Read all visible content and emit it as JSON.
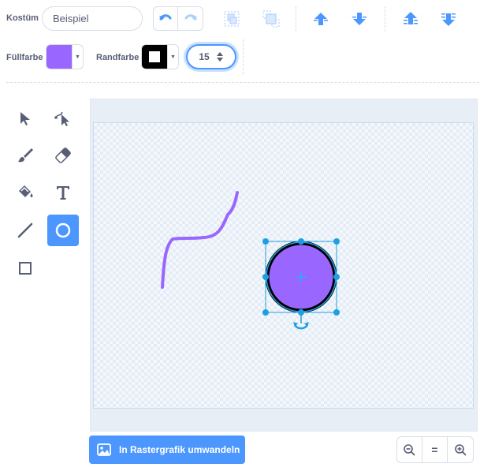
{
  "costume": {
    "label": "Kostüm",
    "name_value": "Beispiel"
  },
  "fill": {
    "label": "Füllfarbe",
    "color": "#9966ff"
  },
  "outline": {
    "label": "Randfarbe",
    "color": "#000000",
    "width_value": "15"
  },
  "toolbar_icons": [
    "undo-icon",
    "redo-icon",
    "group-icon",
    "ungroup-icon",
    "forward-icon",
    "backward-icon",
    "front-icon",
    "back-icon"
  ],
  "tools": [
    "select",
    "reshape",
    "brush",
    "eraser",
    "fill",
    "text",
    "line",
    "circle",
    "rectangle"
  ],
  "active_tool": "circle",
  "convert_button": {
    "label": "In Rastergrafik umwandeln"
  },
  "zoom": {
    "out_icon": "zoom-out-icon",
    "reset_label": "=",
    "in_icon": "zoom-in-icon"
  },
  "colors": {
    "accent": "#4c97ff",
    "text": "#575e75",
    "purple": "#9966ff",
    "selection": "#1f9fe0"
  }
}
